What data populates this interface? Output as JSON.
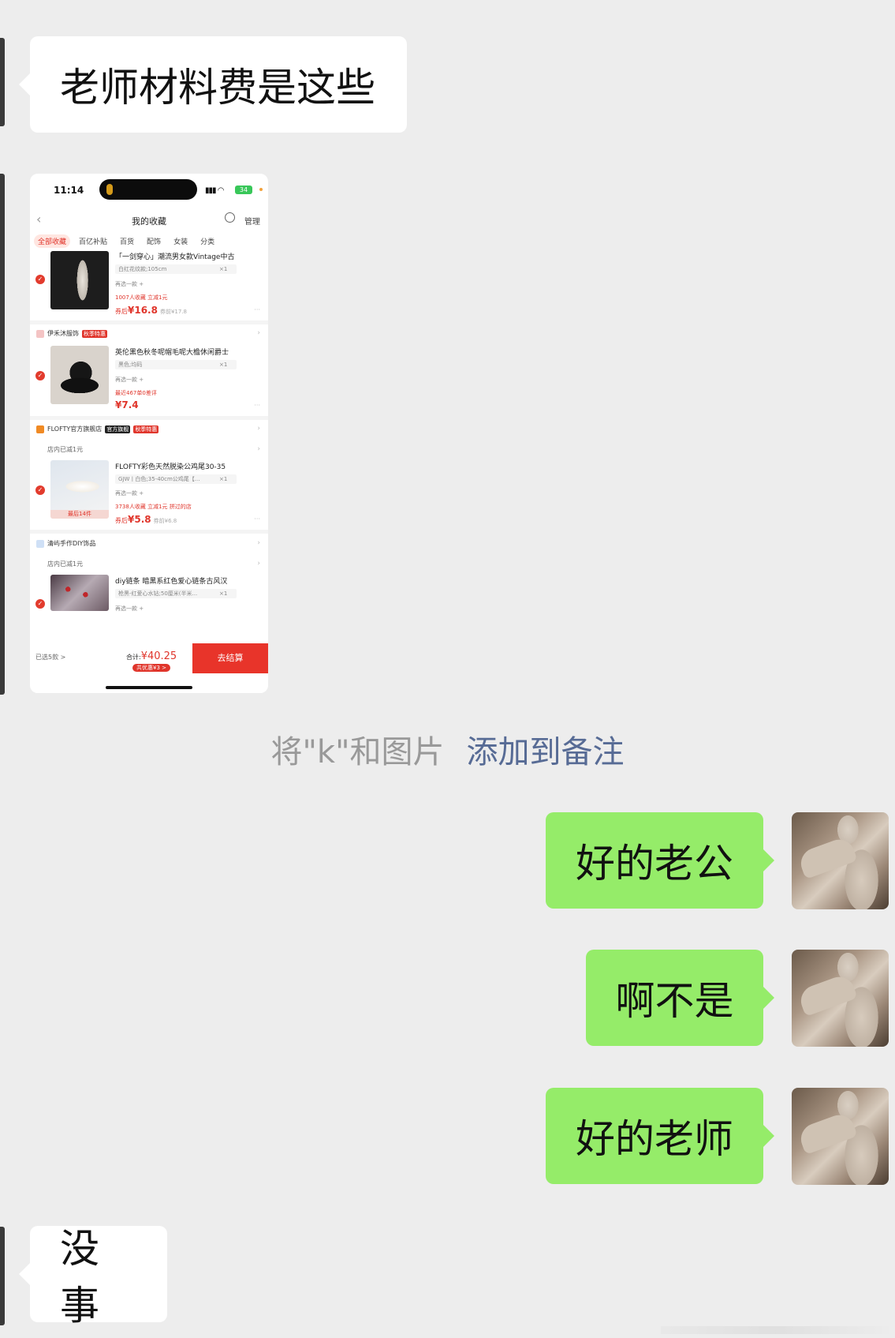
{
  "messages": {
    "m1": "老师材料费是这些",
    "m2": "好的老公",
    "m3": "啊不是",
    "m4": "好的老师",
    "m5": "没事"
  },
  "system_note": {
    "prefix": "将\"k\"和图片",
    "link": "添加到备注"
  },
  "screenshot": {
    "status_time": "11:14",
    "battery": "34",
    "nav_title": "我的收藏",
    "manage": "管理",
    "tabs": [
      "全部收藏",
      "百亿补贴",
      "百货",
      "配饰",
      "女装",
      "分类"
    ],
    "items": [
      {
        "title": "「一剑穿心」潮流男女款Vintage中古",
        "spec": "白红花纹款;105cm",
        "qty": "×1",
        "pick": "再选一款 +",
        "meta": "1007人收藏  立减1元",
        "price_prefix": "券后",
        "price": "¥16.8",
        "orig": "券前¥17.8"
      },
      {
        "shop": "伊禾沐服饰",
        "shop_tag": "秋季特惠",
        "title": "英伦黑色秋冬呢帽毛呢大檐休闲爵士",
        "spec": "黑色;均码",
        "qty": "×1",
        "pick": "再选一款 +",
        "meta": "最近467单0差评",
        "price": "¥7.4"
      },
      {
        "shop": "FLOFTY官方旗舰店",
        "shop_tag1": "官方旗舰",
        "shop_tag2": "秋季特惠",
        "reduce": "店内已减1元",
        "title": "FLOFTY彩色天然脱染公鸡尾30-35",
        "spec": "GJW丨白色;35-40cm公鸡尾【...",
        "qty": "×1",
        "pick": "再选一款 +",
        "meta": "3738人收藏  立减1元  拼过的店",
        "price_prefix": "券后",
        "price": "¥5.8",
        "orig": "券前¥6.8",
        "thumb_badge": "最后14件"
      },
      {
        "shop": "清屿手作DIY饰品",
        "reduce": "店内已减1元",
        "title": "diy链条 暗黑系红色爱心链条古风汉",
        "spec": "枪黑-红爱心水钻;50厘米(半米...",
        "qty": "×1",
        "pick": "再选一款 +"
      }
    ],
    "selected": "已选5款 >",
    "total_label": "合计:",
    "total": "¥40.25",
    "discount": "共优惠¥3 >",
    "checkout": "去结算"
  }
}
